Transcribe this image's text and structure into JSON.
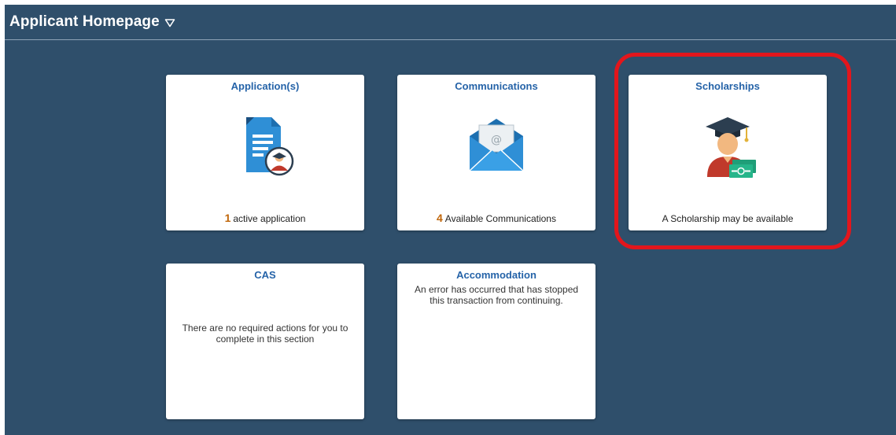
{
  "header": {
    "title": "Applicant Homepage",
    "caret_icon": "triangle-down-outline-icon"
  },
  "tiles": {
    "applications": {
      "title": "Application(s)",
      "icon": "document-graduate-icon",
      "count": "1",
      "footer": "active application"
    },
    "communications": {
      "title": "Communications",
      "icon": "envelope-icon",
      "count": "4",
      "footer": "Available Communications"
    },
    "scholarships": {
      "title": "Scholarships",
      "icon": "graduate-money-icon",
      "footer": "A Scholarship may be available"
    },
    "cas": {
      "title": "CAS",
      "message": "There are no required actions for you to complete in this section"
    },
    "accommodation": {
      "title": "Accommodation",
      "message": "An error has occurred that has stopped this transaction from continuing."
    }
  },
  "colors": {
    "background": "#2f4f6b",
    "tile_title": "#2563a8",
    "count": "#c0660a",
    "highlight": "#e3161c"
  }
}
